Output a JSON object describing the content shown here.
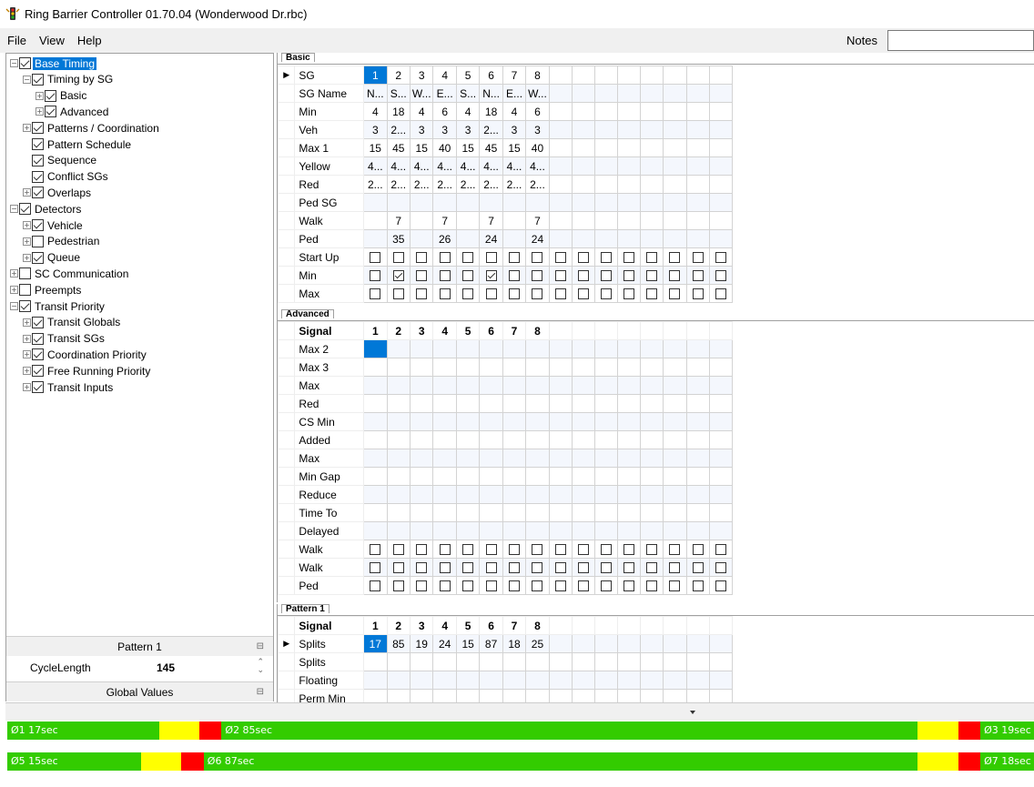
{
  "window": {
    "title": "Ring Barrier Controller 01.70.04 (Wonderwood Dr.rbc)"
  },
  "menu": {
    "file": "File",
    "view": "View",
    "help": "Help",
    "notes_label": "Notes",
    "notes_value": ""
  },
  "tree": [
    {
      "label": "Base Timing",
      "checked": true,
      "expander": "minus",
      "selected": true
    },
    {
      "label": "Timing by SG",
      "checked": true,
      "expander": "minus"
    },
    {
      "label": "Basic",
      "checked": true,
      "expander": "plus"
    },
    {
      "label": "Advanced",
      "checked": true,
      "expander": "plus"
    },
    {
      "label": "Patterns / Coordination",
      "checked": true,
      "expander": "plus"
    },
    {
      "label": "Pattern Schedule",
      "checked": true,
      "expander": ""
    },
    {
      "label": "Sequence",
      "checked": true,
      "expander": ""
    },
    {
      "label": "Conflict SGs",
      "checked": true,
      "expander": ""
    },
    {
      "label": "Overlaps",
      "checked": true,
      "expander": "plus"
    },
    {
      "label": "Detectors",
      "checked": true,
      "expander": "minus"
    },
    {
      "label": "Vehicle",
      "checked": true,
      "expander": "plus"
    },
    {
      "label": "Pedestrian",
      "checked": false,
      "expander": "plus"
    },
    {
      "label": "Queue",
      "checked": true,
      "expander": "plus"
    },
    {
      "label": "SC Communication",
      "checked": false,
      "expander": "plus"
    },
    {
      "label": "Preempts",
      "checked": false,
      "expander": "plus"
    },
    {
      "label": "Transit Priority",
      "checked": true,
      "expander": "minus"
    },
    {
      "label": "Transit Globals",
      "checked": true,
      "expander": "plus"
    },
    {
      "label": "Transit SGs",
      "checked": true,
      "expander": "plus"
    },
    {
      "label": "Coordination Priority",
      "checked": true,
      "expander": "plus"
    },
    {
      "label": "Free Running Priority",
      "checked": true,
      "expander": "plus"
    },
    {
      "label": "Transit Inputs",
      "checked": true,
      "expander": "plus"
    }
  ],
  "props": {
    "pattern_header": "Pattern 1",
    "cycle_label": "CycleLength",
    "cycle_value": "145",
    "global_header": "Global Values"
  },
  "basic": {
    "tab": "Basic",
    "rows": [
      {
        "label": "SG",
        "arrow": true,
        "cells": [
          "1",
          "2",
          "3",
          "4",
          "5",
          "6",
          "7",
          "8"
        ]
      },
      {
        "label": "SG Name",
        "cells": [
          "N...",
          "S...",
          "W...",
          "E...",
          "S...",
          "N...",
          "E...",
          "W..."
        ]
      },
      {
        "label": "Min",
        "cells": [
          "4",
          "18",
          "4",
          "6",
          "4",
          "18",
          "4",
          "6"
        ]
      },
      {
        "label": "Veh",
        "cells": [
          "3",
          "2...",
          "3",
          "3",
          "3",
          "2...",
          "3",
          "3"
        ]
      },
      {
        "label": "Max 1",
        "cells": [
          "15",
          "45",
          "15",
          "40",
          "15",
          "45",
          "15",
          "40"
        ]
      },
      {
        "label": "Yellow",
        "cells": [
          "4...",
          "4...",
          "4...",
          "4...",
          "4...",
          "4...",
          "4...",
          "4..."
        ]
      },
      {
        "label": "Red",
        "cells": [
          "2...",
          "2...",
          "2...",
          "2...",
          "2...",
          "2...",
          "2...",
          "2..."
        ]
      },
      {
        "label": "Ped SG",
        "cells": []
      },
      {
        "label": "Walk",
        "cells": [
          "",
          "7",
          "",
          "7",
          "",
          "7",
          "",
          "7"
        ]
      },
      {
        "label": "Ped",
        "cells": [
          "",
          "35",
          "",
          "26",
          "",
          "24",
          "",
          "24"
        ]
      },
      {
        "label": "Start Up",
        "checkbox": true,
        "checked": []
      },
      {
        "label": "Min",
        "checkbox": true,
        "checked": [
          2,
          6
        ]
      },
      {
        "label": "Max",
        "checkbox": true,
        "checked": []
      }
    ]
  },
  "advanced": {
    "tab": "Advanced",
    "header_label": "Signal",
    "header_cells": [
      "1",
      "2",
      "3",
      "4",
      "5",
      "6",
      "7",
      "8"
    ],
    "rows": [
      {
        "label": "Max 2"
      },
      {
        "label": "Max 3"
      },
      {
        "label": "Max"
      },
      {
        "label": "Red"
      },
      {
        "label": "CS Min"
      },
      {
        "label": "Added"
      },
      {
        "label": "Max"
      },
      {
        "label": "Min Gap"
      },
      {
        "label": "Reduce"
      },
      {
        "label": "Time To"
      },
      {
        "label": "Delayed"
      },
      {
        "label": "Walk",
        "checkbox": true
      },
      {
        "label": "Walk",
        "checkbox": true
      },
      {
        "label": "Ped",
        "checkbox": true
      }
    ]
  },
  "pattern": {
    "tab": "Pattern 1",
    "header_label": "Signal",
    "header_cells": [
      "1",
      "2",
      "3",
      "4",
      "5",
      "6",
      "7",
      "8"
    ],
    "rows": [
      {
        "label": "Splits",
        "arrow": true,
        "cells": [
          "17",
          "85",
          "19",
          "24",
          "15",
          "87",
          "18",
          "25"
        ]
      },
      {
        "label": "Splits"
      },
      {
        "label": "Floating"
      },
      {
        "label": "Perm Min"
      }
    ]
  },
  "rings": [
    {
      "name": "ring-1",
      "segments": [
        {
          "label": "Ø1 17sec",
          "color": "#33cc00",
          "sec": 17
        },
        {
          "label": "",
          "color": "#ffff00",
          "sec": 4.5
        },
        {
          "label": "",
          "color": "#ff0000",
          "sec": 2.5
        },
        {
          "label": "Ø2 85sec",
          "color": "#33cc00",
          "sec": 78
        },
        {
          "label": "",
          "color": "#ffff00",
          "sec": 4.5
        },
        {
          "label": "",
          "color": "#ff0000",
          "sec": 2.5
        },
        {
          "label": "Ø3 19sec",
          "color": "#33cc00",
          "sec": 6
        }
      ]
    },
    {
      "name": "ring-2",
      "segments": [
        {
          "label": "Ø5 15sec",
          "color": "#33cc00",
          "sec": 15
        },
        {
          "label": "",
          "color": "#ffff00",
          "sec": 4.5
        },
        {
          "label": "",
          "color": "#ff0000",
          "sec": 2.5
        },
        {
          "label": "Ø6 87sec",
          "color": "#33cc00",
          "sec": 80
        },
        {
          "label": "",
          "color": "#ffff00",
          "sec": 4.5
        },
        {
          "label": "",
          "color": "#ff0000",
          "sec": 2.5
        },
        {
          "label": "Ø7 18sec",
          "color": "#33cc00",
          "sec": 6
        }
      ]
    }
  ]
}
